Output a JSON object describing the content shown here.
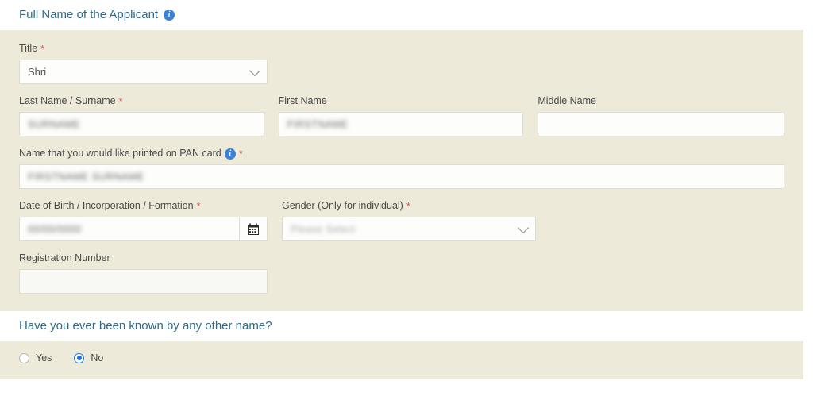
{
  "sections": {
    "name_section": {
      "heading": "Full Name of the Applicant",
      "info_icon": "info-icon"
    },
    "other_name_section": {
      "heading": "Have you ever been known by any other name?"
    }
  },
  "fields": {
    "title": {
      "label": "Title",
      "required": "*",
      "value": "Shri",
      "chevron_icon": "chevron-down-icon"
    },
    "last_name": {
      "label": "Last Name / Surname",
      "required": "*",
      "value": "SURNAME",
      "redacted": true
    },
    "first_name": {
      "label": "First Name",
      "required": "",
      "value": "FIRSTNAME",
      "redacted": true
    },
    "middle_name": {
      "label": "Middle Name",
      "required": "",
      "value": ""
    },
    "pan_card_name": {
      "label": "Name that you would like printed on PAN card",
      "required": "*",
      "info_icon": "info-icon",
      "value": "FIRSTNAME SURNAME",
      "redacted": true
    },
    "date_of_birth": {
      "label": "Date of Birth / Incorporation / Formation",
      "required": "*",
      "value": "00/00/0000",
      "redacted": true,
      "calendar_icon": "calendar-icon"
    },
    "gender": {
      "label": "Gender (Only for individual)",
      "required": "*",
      "placeholder": "Please Select",
      "redacted": true,
      "chevron_icon": "chevron-down-icon"
    },
    "registration_number": {
      "label": "Registration Number",
      "required": "",
      "value": ""
    }
  },
  "radio_group": {
    "name": "known-by-other-name",
    "options": [
      {
        "label": "Yes",
        "checked": false
      },
      {
        "label": "No",
        "checked": true
      }
    ]
  },
  "colors": {
    "panel_background": "#eeead9",
    "heading": "#2e6c8a",
    "required_asterisk": "#d9534f",
    "accent_radio": "#1a73e8",
    "info_icon": "#3b82d6"
  }
}
